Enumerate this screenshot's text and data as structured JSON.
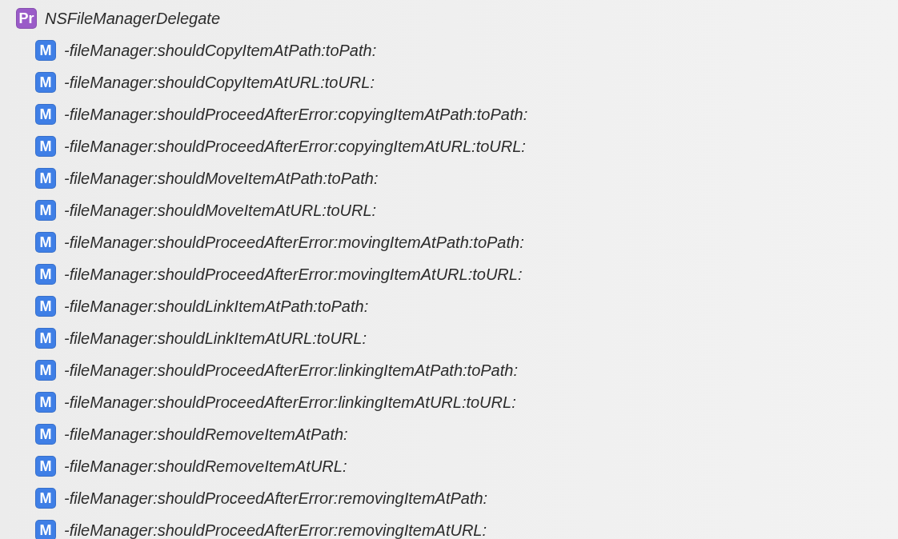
{
  "outline": {
    "kind": "protocol",
    "badge": "Pr",
    "label": "NSFileManagerDelegate",
    "children": [
      {
        "kind": "method",
        "badge": "M",
        "label": "-fileManager:shouldCopyItemAtPath:toPath:"
      },
      {
        "kind": "method",
        "badge": "M",
        "label": "-fileManager:shouldCopyItemAtURL:toURL:"
      },
      {
        "kind": "method",
        "badge": "M",
        "label": "-fileManager:shouldProceedAfterError:copyingItemAtPath:toPath:"
      },
      {
        "kind": "method",
        "badge": "M",
        "label": "-fileManager:shouldProceedAfterError:copyingItemAtURL:toURL:"
      },
      {
        "kind": "method",
        "badge": "M",
        "label": "-fileManager:shouldMoveItemAtPath:toPath:"
      },
      {
        "kind": "method",
        "badge": "M",
        "label": "-fileManager:shouldMoveItemAtURL:toURL:"
      },
      {
        "kind": "method",
        "badge": "M",
        "label": "-fileManager:shouldProceedAfterError:movingItemAtPath:toPath:"
      },
      {
        "kind": "method",
        "badge": "M",
        "label": "-fileManager:shouldProceedAfterError:movingItemAtURL:toURL:"
      },
      {
        "kind": "method",
        "badge": "M",
        "label": "-fileManager:shouldLinkItemAtPath:toPath:"
      },
      {
        "kind": "method",
        "badge": "M",
        "label": "-fileManager:shouldLinkItemAtURL:toURL:"
      },
      {
        "kind": "method",
        "badge": "M",
        "label": "-fileManager:shouldProceedAfterError:linkingItemAtPath:toPath:"
      },
      {
        "kind": "method",
        "badge": "M",
        "label": "-fileManager:shouldProceedAfterError:linkingItemAtURL:toURL:"
      },
      {
        "kind": "method",
        "badge": "M",
        "label": "-fileManager:shouldRemoveItemAtPath:"
      },
      {
        "kind": "method",
        "badge": "M",
        "label": "-fileManager:shouldRemoveItemAtURL:"
      },
      {
        "kind": "method",
        "badge": "M",
        "label": "-fileManager:shouldProceedAfterError:removingItemAtPath:"
      },
      {
        "kind": "method",
        "badge": "M",
        "label": "-fileManager:shouldProceedAfterError:removingItemAtURL:"
      }
    ]
  }
}
